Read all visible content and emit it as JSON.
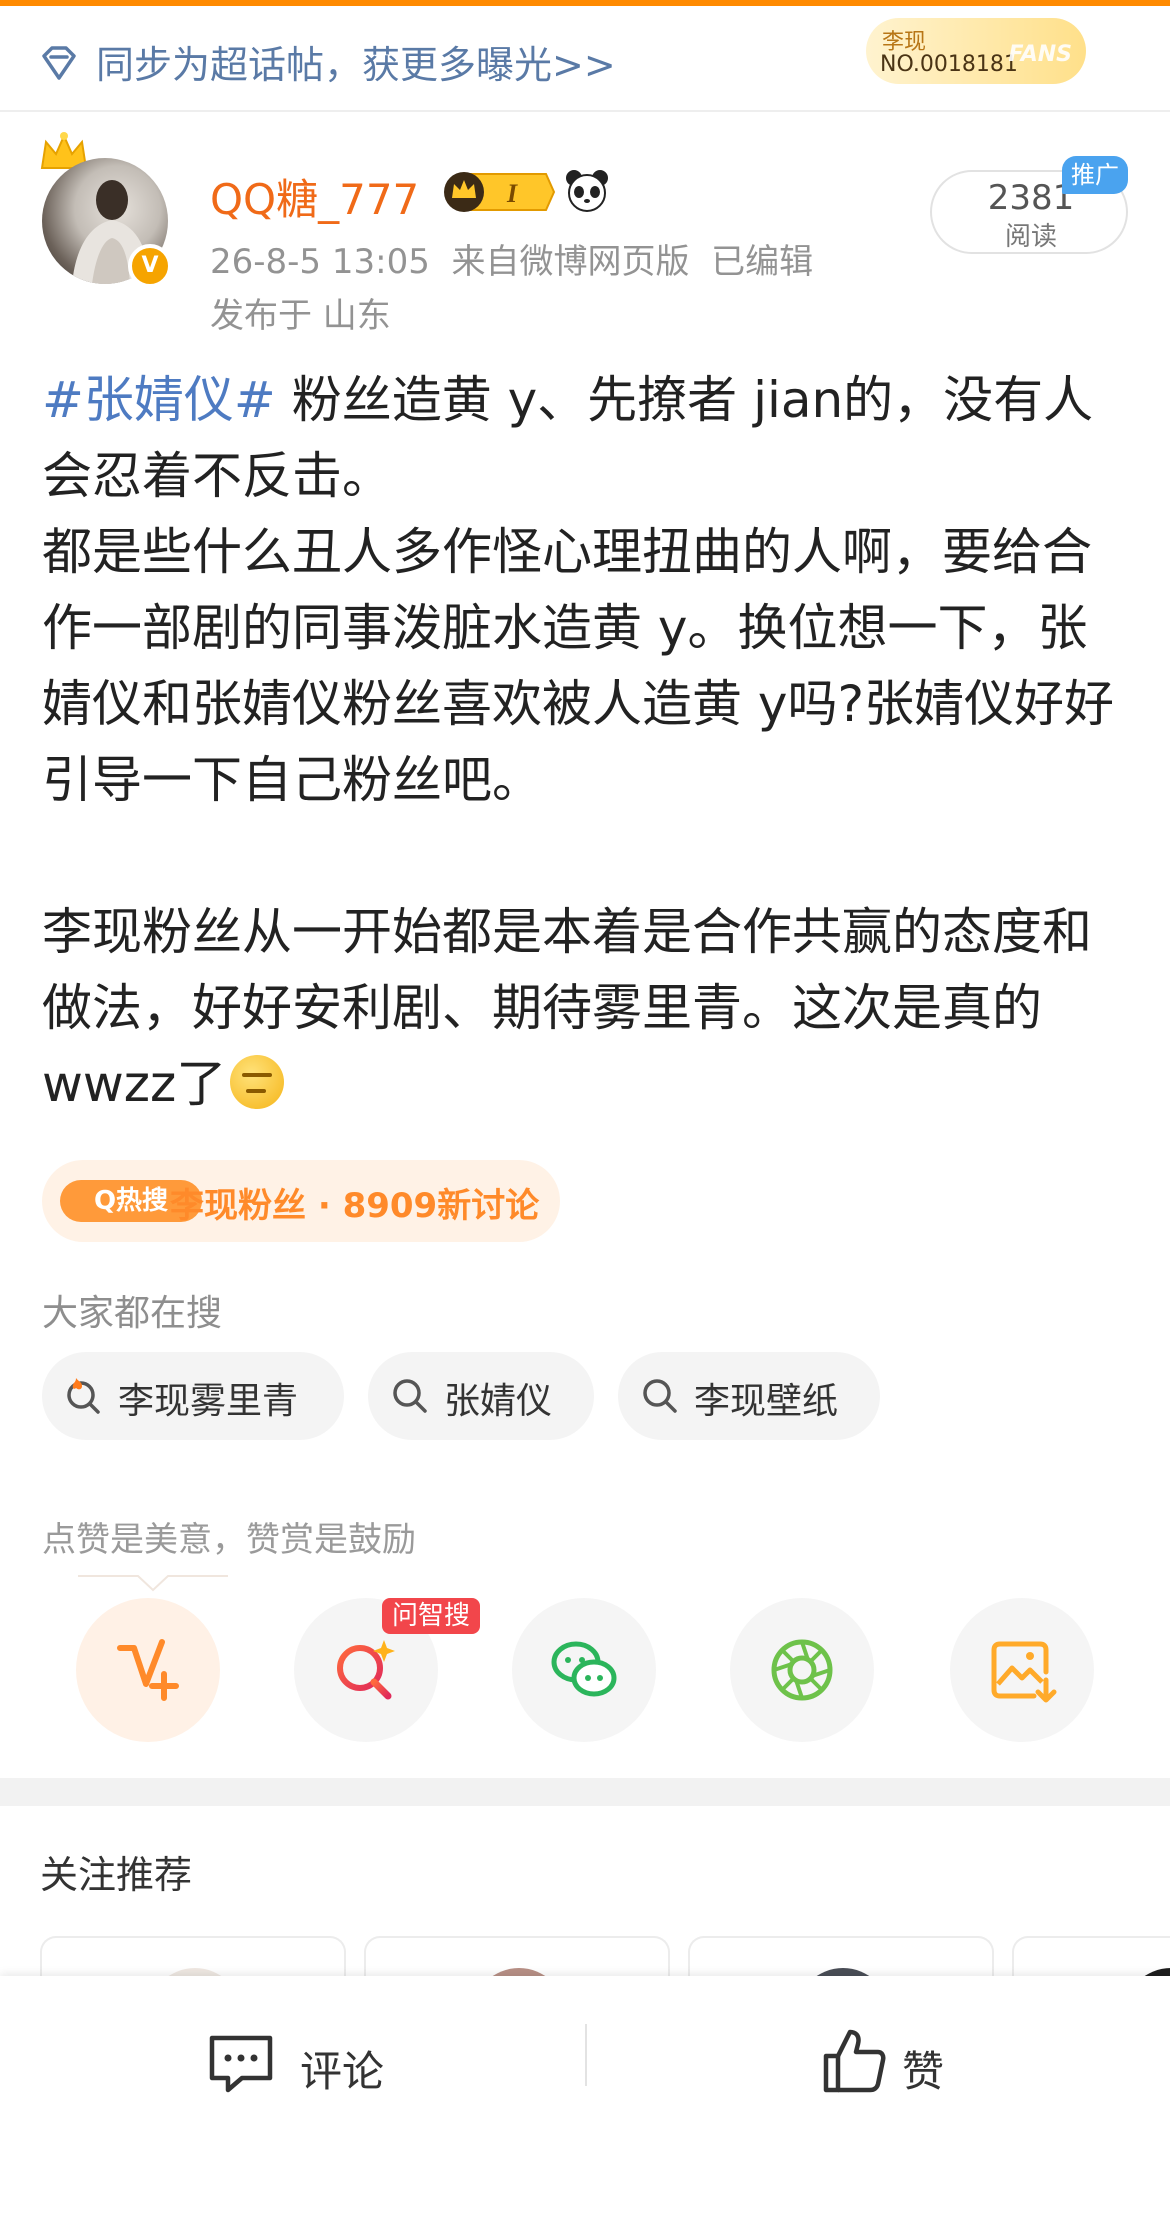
{
  "sync_bar": {
    "text": "同步为超话帖，获更多曝光>>"
  },
  "fans_badge": {
    "name": "李现",
    "number": "NO.0018181",
    "word": "FANS"
  },
  "post": {
    "username": "QQ糖_777",
    "vip_level": "I",
    "timestamp": "26-8-5 13:05",
    "source": "来自微博网页版",
    "edited": "已编辑",
    "location": "发布于 山东",
    "read_count": "2381",
    "read_label": "阅读",
    "promo_label": "推广",
    "hashtag": "#张婧仪#",
    "body_first": " 粉丝造黄 y、先撩者 jian的，没有人会忍着不反击。",
    "body_lines": [
      "都是些什么丑人多作怪心理扭曲的人啊，要给合作一部剧的同事泼脏水造黄 y。换位想一下，张婧仪和张婧仪粉丝喜欢被人造黄 y吗?张婧仪好好引导一下自己粉丝吧。",
      "",
      "李现粉丝从一开始都是本着是合作共赢的态度和做法，好好安利剧、期待雾里青。这次是真的 wwzz了"
    ],
    "emoji": "thinking-face"
  },
  "hot_topic": {
    "tag": "Q热搜",
    "text": "李现粉丝 · 8909新讨论"
  },
  "search": {
    "title": "大家都在搜",
    "chips": [
      {
        "label": "李现雾里青",
        "icon": "hot-search-icon"
      },
      {
        "label": "张婧仪",
        "icon": "search-icon"
      },
      {
        "label": "李现壁纸",
        "icon": "search-icon"
      }
    ]
  },
  "reward": {
    "text": "点赞是美意，赞赏是鼓励"
  },
  "actions": [
    {
      "name": "reward",
      "icon": "v-plus-icon"
    },
    {
      "name": "ask-search",
      "icon": "ai-search-icon",
      "badge": "问智搜"
    },
    {
      "name": "wechat-share",
      "icon": "wechat-icon"
    },
    {
      "name": "moments-share",
      "icon": "moments-icon"
    },
    {
      "name": "save-image",
      "icon": "save-image-icon"
    }
  ],
  "recommend": {
    "title": "关注推荐"
  },
  "bottom": {
    "comment": "评论",
    "like": "赞"
  },
  "colors": {
    "accent_orange": "#f06a18",
    "link_blue": "#4e7bc2",
    "hot_orange": "#ff8a2a",
    "badge_red": "#f2464b",
    "wechat_green": "#2bb55b"
  }
}
